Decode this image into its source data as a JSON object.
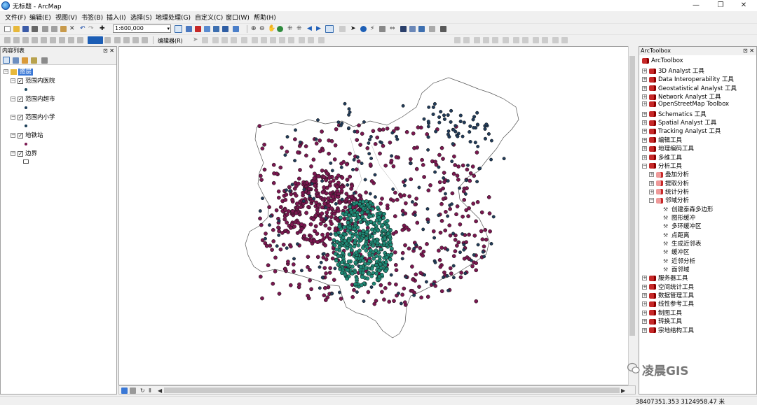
{
  "app": {
    "title": "无标题 - ArcMap"
  },
  "window_controls": {
    "minimize": "—",
    "maximize": "❐",
    "close": "✕"
  },
  "menu": [
    "文件(F)",
    "编辑(E)",
    "视图(V)",
    "书签(B)",
    "插入(I)",
    "选择(S)",
    "地理处理(G)",
    "自定义(C)",
    "窗口(W)",
    "帮助(H)"
  ],
  "toolbar": {
    "scale": "1:600,000",
    "editor_label": "编辑器(R)"
  },
  "toc": {
    "title": "内容列表",
    "pin": "⊡ ✕",
    "root": "图层",
    "layers": [
      {
        "name": "范围内医院",
        "color": "#1e4a5e"
      },
      {
        "name": "范围内超市",
        "color": "#1f3f5c"
      },
      {
        "name": "范围内小学",
        "color": "#1b3e56"
      },
      {
        "name": "地铁站",
        "color": "#7a1850"
      },
      {
        "name": "边界",
        "color": "#ffffff"
      }
    ]
  },
  "toolbox": {
    "title": "ArcToolbox",
    "pin": "⊡ ✕",
    "root": "ArcToolbox",
    "items": [
      {
        "label": "3D Analyst 工具",
        "level": 0,
        "expanded": false
      },
      {
        "label": "Data Interoperability 工具",
        "level": 0,
        "expanded": false
      },
      {
        "label": "Geostatistical Analyst 工具",
        "level": 0,
        "expanded": false
      },
      {
        "label": "Network Analyst 工具",
        "level": 0,
        "expanded": false
      },
      {
        "label": "OpenStreetMap Toolbox",
        "level": 0,
        "expanded": false
      },
      {
        "label": "Schematics 工具",
        "level": 0,
        "expanded": false
      },
      {
        "label": "Spatial Analyst 工具",
        "level": 0,
        "expanded": false
      },
      {
        "label": "Tracking Analyst 工具",
        "level": 0,
        "expanded": false
      },
      {
        "label": "编辑工具",
        "level": 0,
        "expanded": false
      },
      {
        "label": "地理编码工具",
        "level": 0,
        "expanded": false
      },
      {
        "label": "多维工具",
        "level": 0,
        "expanded": false
      },
      {
        "label": "分析工具",
        "level": 0,
        "expanded": true
      },
      {
        "label": "叠加分析",
        "level": 1,
        "expanded": false
      },
      {
        "label": "提取分析",
        "level": 1,
        "expanded": false
      },
      {
        "label": "统计分析",
        "level": 1,
        "expanded": false
      },
      {
        "label": "邻域分析",
        "level": 1,
        "expanded": true
      },
      {
        "label": "创建泰森多边形",
        "level": 2,
        "tool": true
      },
      {
        "label": "图形缓冲",
        "level": 2,
        "tool": true
      },
      {
        "label": "多环缓冲区",
        "level": 2,
        "tool": true
      },
      {
        "label": "点距离",
        "level": 2,
        "tool": true
      },
      {
        "label": "生成近邻表",
        "level": 2,
        "tool": true
      },
      {
        "label": "缓冲区",
        "level": 2,
        "tool": true
      },
      {
        "label": "近邻分析",
        "level": 2,
        "tool": true
      },
      {
        "label": "面邻域",
        "level": 2,
        "tool": true
      },
      {
        "label": "服务器工具",
        "level": 0,
        "expanded": false
      },
      {
        "label": "空间统计工具",
        "level": 0,
        "expanded": false
      },
      {
        "label": "数据管理工具",
        "level": 0,
        "expanded": false
      },
      {
        "label": "线性参考工具",
        "level": 0,
        "expanded": false
      },
      {
        "label": "制图工具",
        "level": 0,
        "expanded": false
      },
      {
        "label": "转换工具",
        "level": 0,
        "expanded": false
      },
      {
        "label": "宗地结构工具",
        "level": 0,
        "expanded": false
      }
    ]
  },
  "status": {
    "coords": "38407351.353  3124958.47 米"
  },
  "watermark": "凌晨GIS",
  "colors": {
    "metro": "#7a1850",
    "cluster": "#1f8a76",
    "poi": "#223c5a"
  }
}
